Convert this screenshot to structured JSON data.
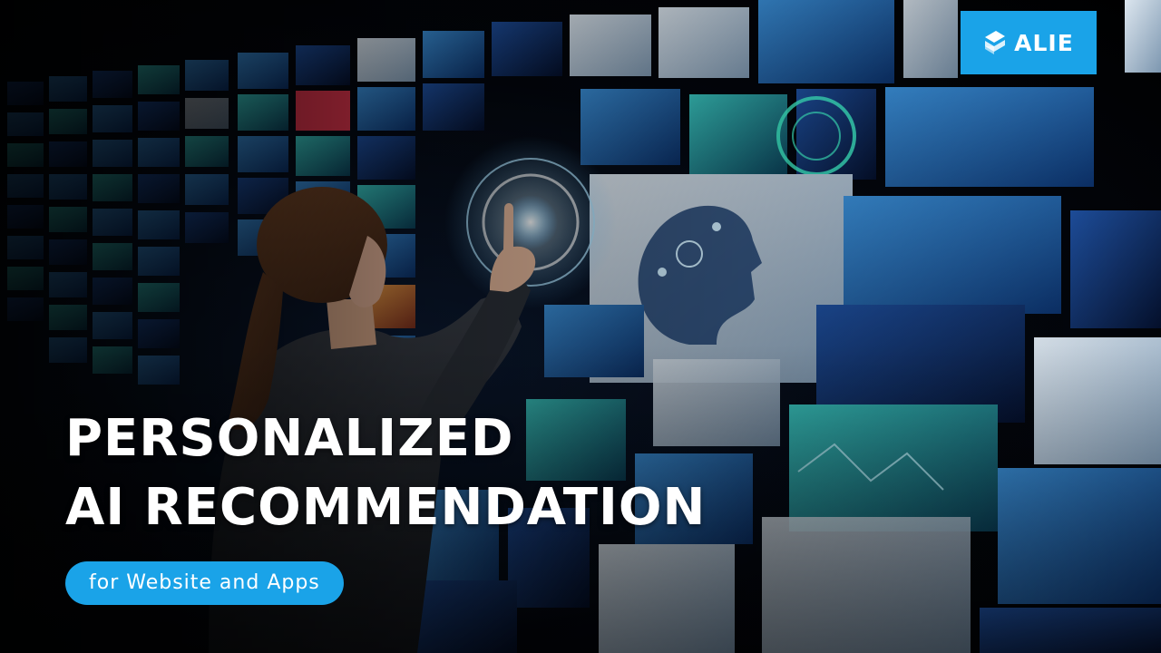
{
  "brand": {
    "name": "ALIE",
    "icon": "alie-logo-icon",
    "color": "#1aa3e8"
  },
  "headline": {
    "line1": "PERSONALIZED",
    "line2": "AI RECOMMENDATION"
  },
  "subtitle": "for Website and Apps",
  "colors": {
    "accent": "#1aa3e8",
    "text": "#ffffff",
    "background": "#000000"
  }
}
